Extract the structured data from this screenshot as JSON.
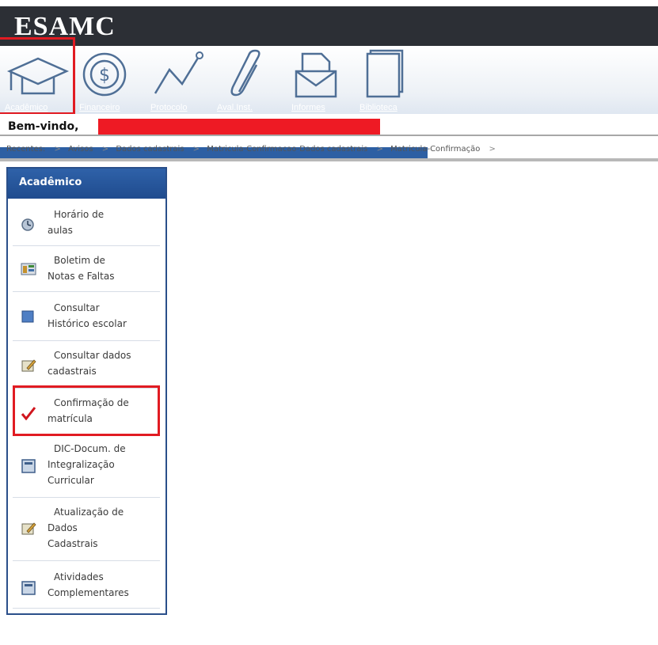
{
  "app": {
    "logo": "ESAMC"
  },
  "toolbar": {
    "items": [
      {
        "label": "Acadêmico",
        "icon": "graduation-cap-icon"
      },
      {
        "label": "Financeiro",
        "icon": "dollar-coin-icon"
      },
      {
        "label": "Protocolo",
        "icon": "line-graph-icon"
      },
      {
        "label": "Aval.Inst.",
        "icon": "paperclip-icon"
      },
      {
        "label": "Informes",
        "icon": "envelope-document-icon"
      },
      {
        "label": "Biblioteca",
        "icon": "book-icon"
      }
    ]
  },
  "welcome": {
    "text": "Bem-vindo,"
  },
  "breadcrumb": {
    "label": "Recentes:",
    "items": [
      "Avisos",
      "Dados cadastrais",
      "Matricula-Confirmacao-Dados cadastrais",
      "Matricula-Confirmação"
    ],
    "separator": ">"
  },
  "sidebar": {
    "title": "Acadêmico",
    "items": [
      {
        "lines": [
          "Horário de",
          "aulas"
        ],
        "icon": "clock-icon"
      },
      {
        "lines": [
          "Boletim de",
          "Notas e Faltas"
        ],
        "icon": "report-card-icon"
      },
      {
        "lines": [
          "Consultar",
          "Histórico escolar"
        ],
        "icon": "history-icon"
      },
      {
        "lines": [
          "Consultar dados",
          "cadastrais"
        ],
        "icon": "edit-data-icon"
      },
      {
        "lines": [
          "Confirmação de",
          "matrícula"
        ],
        "icon": "checkmark-icon"
      },
      {
        "lines": [
          "DIC-Docum. de",
          "Integralização",
          "Curricular"
        ],
        "icon": "document-icon"
      },
      {
        "lines": [
          "Atualização de",
          "Dados",
          "Cadastrais"
        ],
        "icon": "edit-data-icon"
      },
      {
        "lines": [
          "Atividades",
          "Complementares"
        ],
        "icon": "document-icon"
      }
    ]
  },
  "colors": {
    "header": "#2c2f35",
    "accent_blue": "#2d5fa3",
    "highlight_red": "#e11b22",
    "redaction": "#ee1a24"
  }
}
